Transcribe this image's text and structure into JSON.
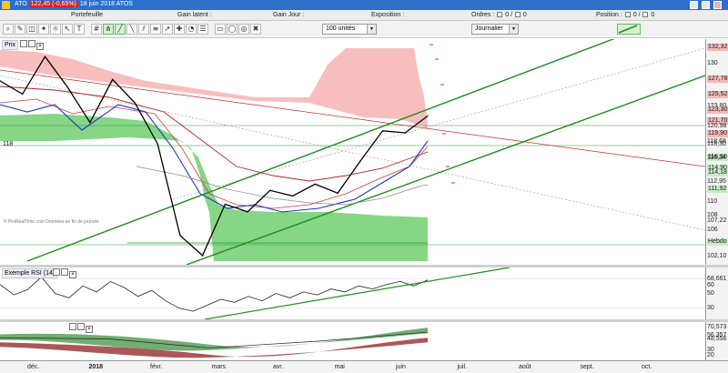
{
  "titlebar": {
    "app_name": "ATO",
    "quote": "122,45 (-0,65%)",
    "subtitle": "18 juin 2018 ATOS",
    "app_icon": "app-icon",
    "window_buttons": [
      "minimize-icon",
      "maximize-icon",
      "close-icon"
    ]
  },
  "infobar": {
    "portefeuille": "Portefeuille",
    "gain_latent": "Gain latent :",
    "gain_jour": "Gain Jour :",
    "exposition": "Exposition :",
    "ordres_label": "Ordres :",
    "ordres_a": "0",
    "ordres_b": "0",
    "position_label": "Position :",
    "position_a": "0",
    "position_b": "0"
  },
  "toolbar": {
    "quantity": "100 unités",
    "period": "Journalier",
    "tools": [
      "zoom-icon",
      "pencil-icon",
      "eraser-icon",
      "magic-icon",
      "brightness-icon",
      "cursor-icon",
      "text-icon",
      "grid-icon",
      "pitchfork-icon",
      "trend-up-icon",
      "trend-down-icon",
      "channel-icon",
      "fibonacci-icon",
      "arrow-icon",
      "cross-icon",
      "gann-icon",
      "levels-icon",
      "rectangle-icon",
      "ellipse-icon",
      "target-icon",
      "delete-icon"
    ]
  },
  "price_panel": {
    "label": "Prix",
    "watermark": "© ProRealTime.com Données en fin de journée",
    "left_level": "118",
    "ticks": [
      {
        "label": "132,32",
        "y": 132.32,
        "box": "#f4b8b8"
      },
      {
        "label": "130",
        "y": 130
      },
      {
        "label": "127,78",
        "y": 127.78,
        "box": "#f4b8b8"
      },
      {
        "label": "125,52",
        "y": 125.52,
        "box": "#f4b8b8"
      },
      {
        "label": "123,80",
        "y": 123.8
      },
      {
        "label": "123,30",
        "y": 123.3,
        "box": "#f4b8b8"
      },
      {
        "label": "121,70",
        "y": 121.7,
        "box": "#f4b8b8"
      },
      {
        "label": "120,98",
        "y": 120.98
      },
      {
        "label": "119,90",
        "y": 119.9,
        "box": "#f4b8b8"
      },
      {
        "label": "118,68",
        "y": 118.68
      },
      {
        "label": "118,30",
        "y": 118.3
      },
      {
        "label": "116,50",
        "y": 116.5,
        "box": "#c8ecc8"
      },
      {
        "label": "116,34",
        "y": 116.34
      },
      {
        "label": "114,90",
        "y": 114.9,
        "box": "#c8ecc8"
      },
      {
        "label": "114,18",
        "y": 114.18,
        "box": "#c8ecc8"
      },
      {
        "label": "112,95",
        "y": 112.95
      },
      {
        "label": "111,92",
        "y": 111.92,
        "box": "#c8ecc8"
      },
      {
        "label": "110",
        "y": 110
      },
      {
        "label": "108",
        "y": 108
      },
      {
        "label": "107,22",
        "y": 107.22
      },
      {
        "label": "106",
        "y": 106
      },
      {
        "label": "Hebdo",
        "y": 104.2,
        "box": "#c8ecc8"
      },
      {
        "label": "102,10",
        "y": 102.1
      }
    ]
  },
  "rsi_panel": {
    "label": "Exemple RSI (14)",
    "ticks": [
      {
        "label": "68,661",
        "y": 68.661
      },
      {
        "label": "60",
        "y": 60
      },
      {
        "label": "50",
        "y": 50
      },
      {
        "label": "30",
        "y": 30
      }
    ]
  },
  "lower_panel": {
    "ticks": [
      {
        "label": "70,573",
        "y": 70.573
      },
      {
        "label": "56,357",
        "y": 56.357
      },
      {
        "label": "48,556",
        "y": 48.556
      },
      {
        "label": "30",
        "y": 30
      },
      {
        "label": "20",
        "y": 20
      }
    ]
  },
  "x_axis": [
    {
      "label": "déc.",
      "x": 0.0,
      "bold": false
    },
    {
      "label": "2018",
      "x": 1.0,
      "bold": true
    },
    {
      "label": "févr.",
      "x": 2.0,
      "bold": false
    },
    {
      "label": "mars",
      "x": 3.0,
      "bold": false
    },
    {
      "label": "avr.",
      "x": 4.0,
      "bold": false
    },
    {
      "label": "mai",
      "x": 5.0,
      "bold": false
    },
    {
      "label": "juin",
      "x": 6.0,
      "bold": false
    },
    {
      "label": "juil.",
      "x": 7.0,
      "bold": false
    },
    {
      "label": "août",
      "x": 8.0,
      "bold": false
    },
    {
      "label": "sept.",
      "x": 9.0,
      "bold": false
    },
    {
      "label": "oct.",
      "x": 10.0,
      "bold": false
    }
  ],
  "chart_data": {
    "type": "line",
    "title": "",
    "xlabel": "",
    "ylabel": "",
    "ylim": [
      101.5,
      133
    ],
    "categories": [
      "déc.",
      "2018",
      "févr.",
      "mars",
      "avr.",
      "mai",
      "juin"
    ],
    "series": [
      {
        "values": [
          127.5,
          125.6,
          131,
          126.6,
          121.5,
          127.7,
          124.3,
          118.4,
          105.2,
          102.3,
          109.7,
          108.6,
          111.7,
          110.9,
          112.6,
          111.3,
          115.9,
          120.3,
          120,
          122.45
        ]
      }
    ],
    "colors": {
      "price": "#000000",
      "cloud_red": "#f7b0b0",
      "cloud_green": "#7ad47a",
      "trend": "#1e8c1e",
      "ma_blue": "#1f35c8",
      "ma_red": "#b02525"
    }
  }
}
